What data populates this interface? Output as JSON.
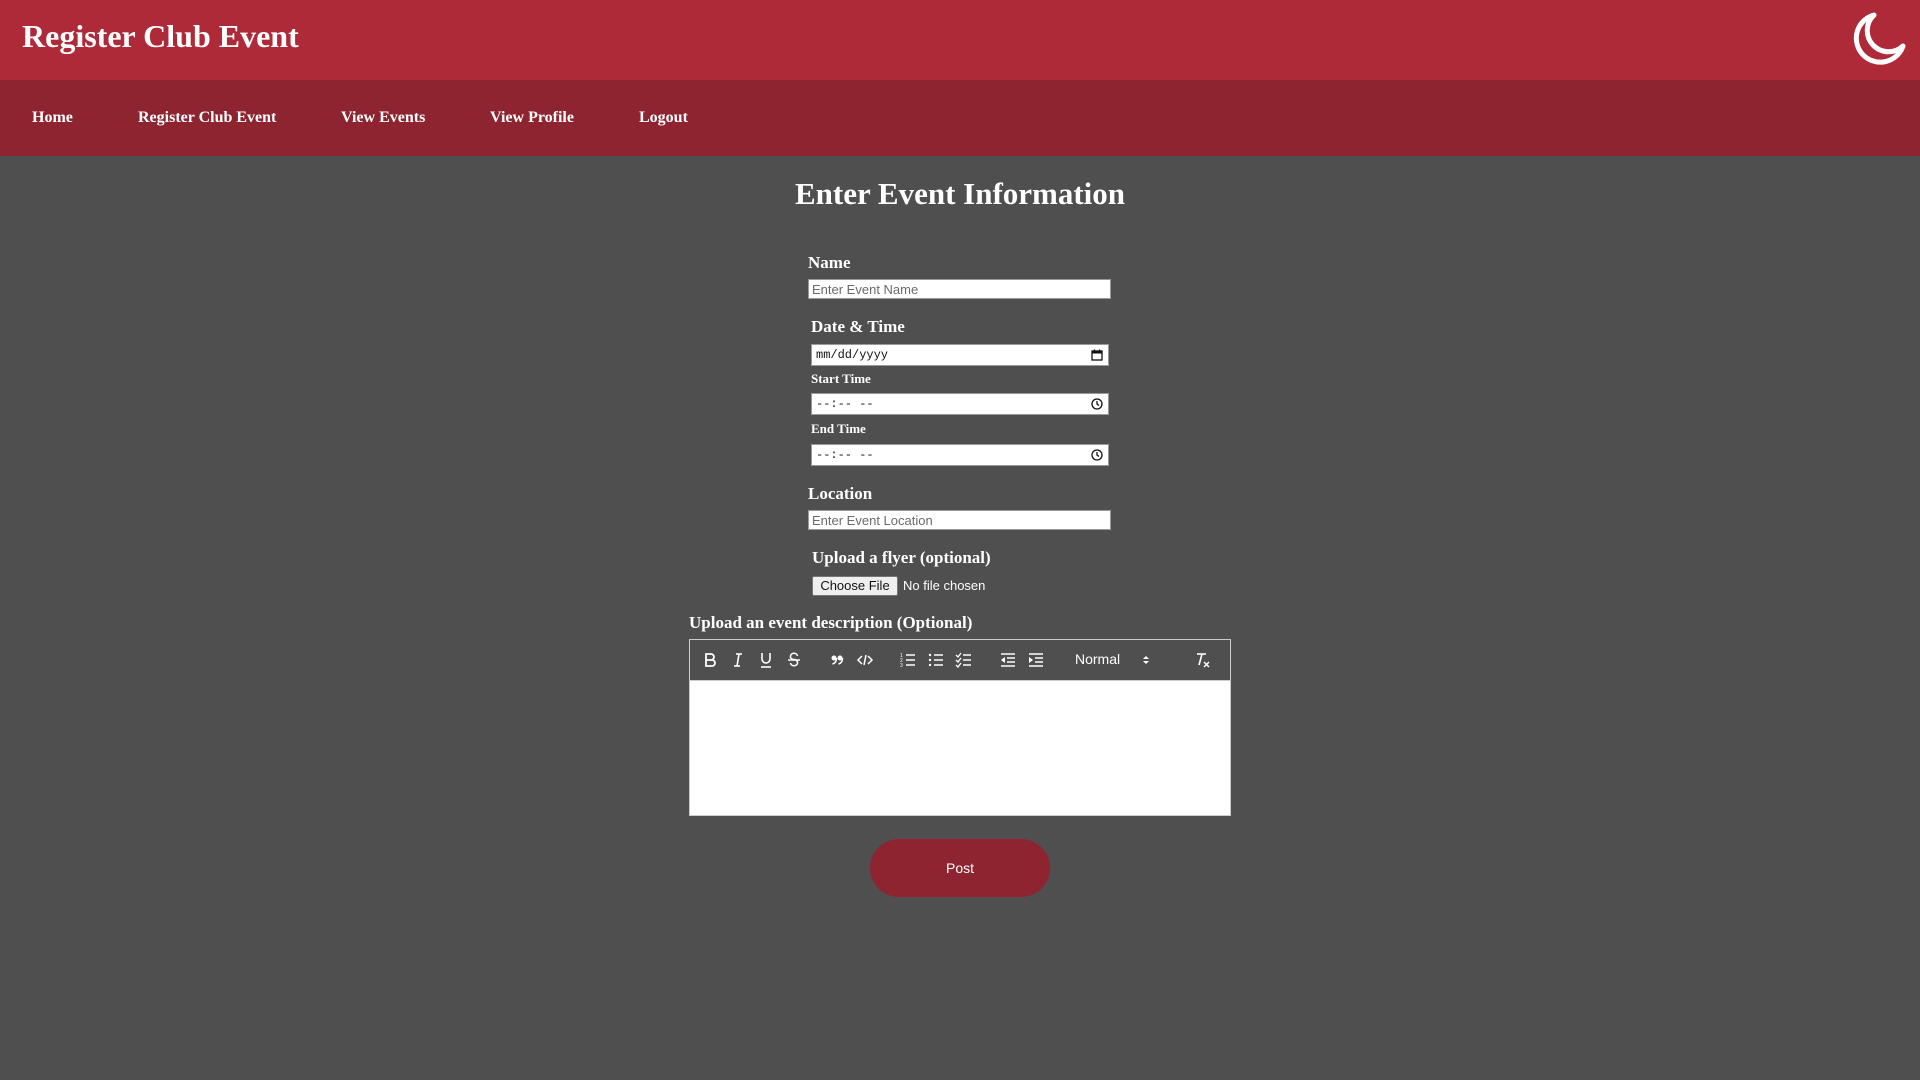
{
  "header": {
    "title": "Register Club Event",
    "theme_toggle_icon": "moon-icon"
  },
  "nav": {
    "items": [
      {
        "label": "Home"
      },
      {
        "label": "Register Club Event"
      },
      {
        "label": "View Events"
      },
      {
        "label": "View Profile"
      },
      {
        "label": "Logout"
      }
    ]
  },
  "form": {
    "heading": "Enter Event Information",
    "name": {
      "label": "Name",
      "placeholder": "Enter Event Name",
      "value": ""
    },
    "datetime": {
      "label": "Date & Time",
      "date_placeholder": "mm/dd/yyyy",
      "start_label": "Start Time",
      "start_placeholder": "--:-- --",
      "end_label": "End Time",
      "end_placeholder": "--:-- --"
    },
    "location": {
      "label": "Location",
      "placeholder": "Enter Event Location",
      "value": ""
    },
    "flyer": {
      "label": "Upload a flyer (optional)",
      "button": "Choose File",
      "status": "No file chosen"
    },
    "description": {
      "label": "Upload an event description (Optional)",
      "toolbar": {
        "buttons": [
          "bold-icon",
          "italic-icon",
          "underline-icon",
          "strikethrough-icon",
          "blockquote-icon",
          "code-block-icon",
          "ordered-list-icon",
          "bullet-list-icon",
          "checklist-icon",
          "outdent-icon",
          "indent-icon",
          "clear-format-icon"
        ],
        "header_select": "Normal"
      }
    },
    "submit_label": "Post"
  },
  "colors": {
    "header_bg": "#ae2a38",
    "nav_bg": "#8f2431",
    "page_bg": "#4f4f4f",
    "button_bg": "#8f2431"
  }
}
